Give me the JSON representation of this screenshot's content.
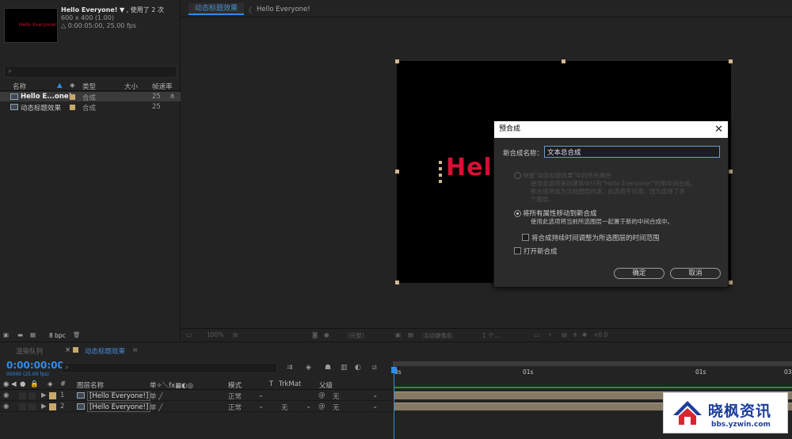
{
  "project": {
    "comp_name": "Hello Everyone!",
    "comp_name_suffix": "▼ ,",
    "usage": "使用了 2 次",
    "dimensions": "600 x 400 (1.00)",
    "duration": "△ 0:00:05:00, 25.00 fps",
    "thumb_text": "Hello Everyone!",
    "columns": {
      "name": "名称",
      "type": "类型",
      "size": "大小",
      "framerate": "帧速率"
    },
    "items": [
      {
        "name": "Hello E...one!",
        "type": "合成",
        "fps": "25",
        "selected": true
      },
      {
        "name": "动态标题效果",
        "type": "合成",
        "fps": "25",
        "selected": false
      }
    ],
    "bpc": "8 bpc"
  },
  "viewer": {
    "tab_active": "动态标题效果",
    "tab_secondary": "Hello Everyone!",
    "canvas_text": "Hel",
    "footer": {
      "zoom": "100%",
      "resolution": "(完整)",
      "camera": "活动摄像机",
      "views": "1 个...",
      "exposure": "+0.0"
    }
  },
  "dialog": {
    "title": "预合成",
    "name_label": "新合成名称：",
    "name_value": "文本总合成",
    "option1_title": "保留\"动态标题效果\"中的所有属性",
    "option1_desc1": "使用此选项来创建其中只有\"Hello Everyone!\"的新中间合成。",
    "option1_desc2": "新合成将成为当前图层的源。此选项不可用，因为选择了多",
    "option1_desc3": "个图层。",
    "option2_title": "将所有属性移动到新合成",
    "option2_desc": "使用此选项将当前所选图层一起置于新的中间合成中。",
    "checkbox1_label": "将合成持续时间调整为所选图层的时间范围",
    "checkbox2_label": "打开新合成",
    "ok_label": "确定",
    "cancel_label": "取消"
  },
  "timeline": {
    "tab_render": "渲染队列",
    "tab_comp": "动态标题效果",
    "timecode": "0:00:00:00",
    "timecode_sub": "00000 (25.00 fps)",
    "columns": {
      "num": "#",
      "layer_name": "图层名称",
      "mode": "模式",
      "t": "T",
      "trkmat": "TrkMat",
      "parent": "父级"
    },
    "layers": [
      {
        "num": "1",
        "name": "[Hello Everyone!]",
        "mode": "正常",
        "trkmat": "",
        "parent": "无"
      },
      {
        "num": "2",
        "name": "[Hello Everyone!]",
        "mode": "正常",
        "trkmat": "无",
        "parent": "无"
      }
    ],
    "ruler": [
      "0s",
      "01s",
      "01s",
      "03"
    ]
  },
  "watermark": {
    "title": "晓枫资讯",
    "url": "bbs.yzwin.com"
  },
  "colors": {
    "accent": "#2d8ceb",
    "text_red": "#d90f35",
    "handle": "#d2b894",
    "brand_blue": "#1d3f9c"
  }
}
